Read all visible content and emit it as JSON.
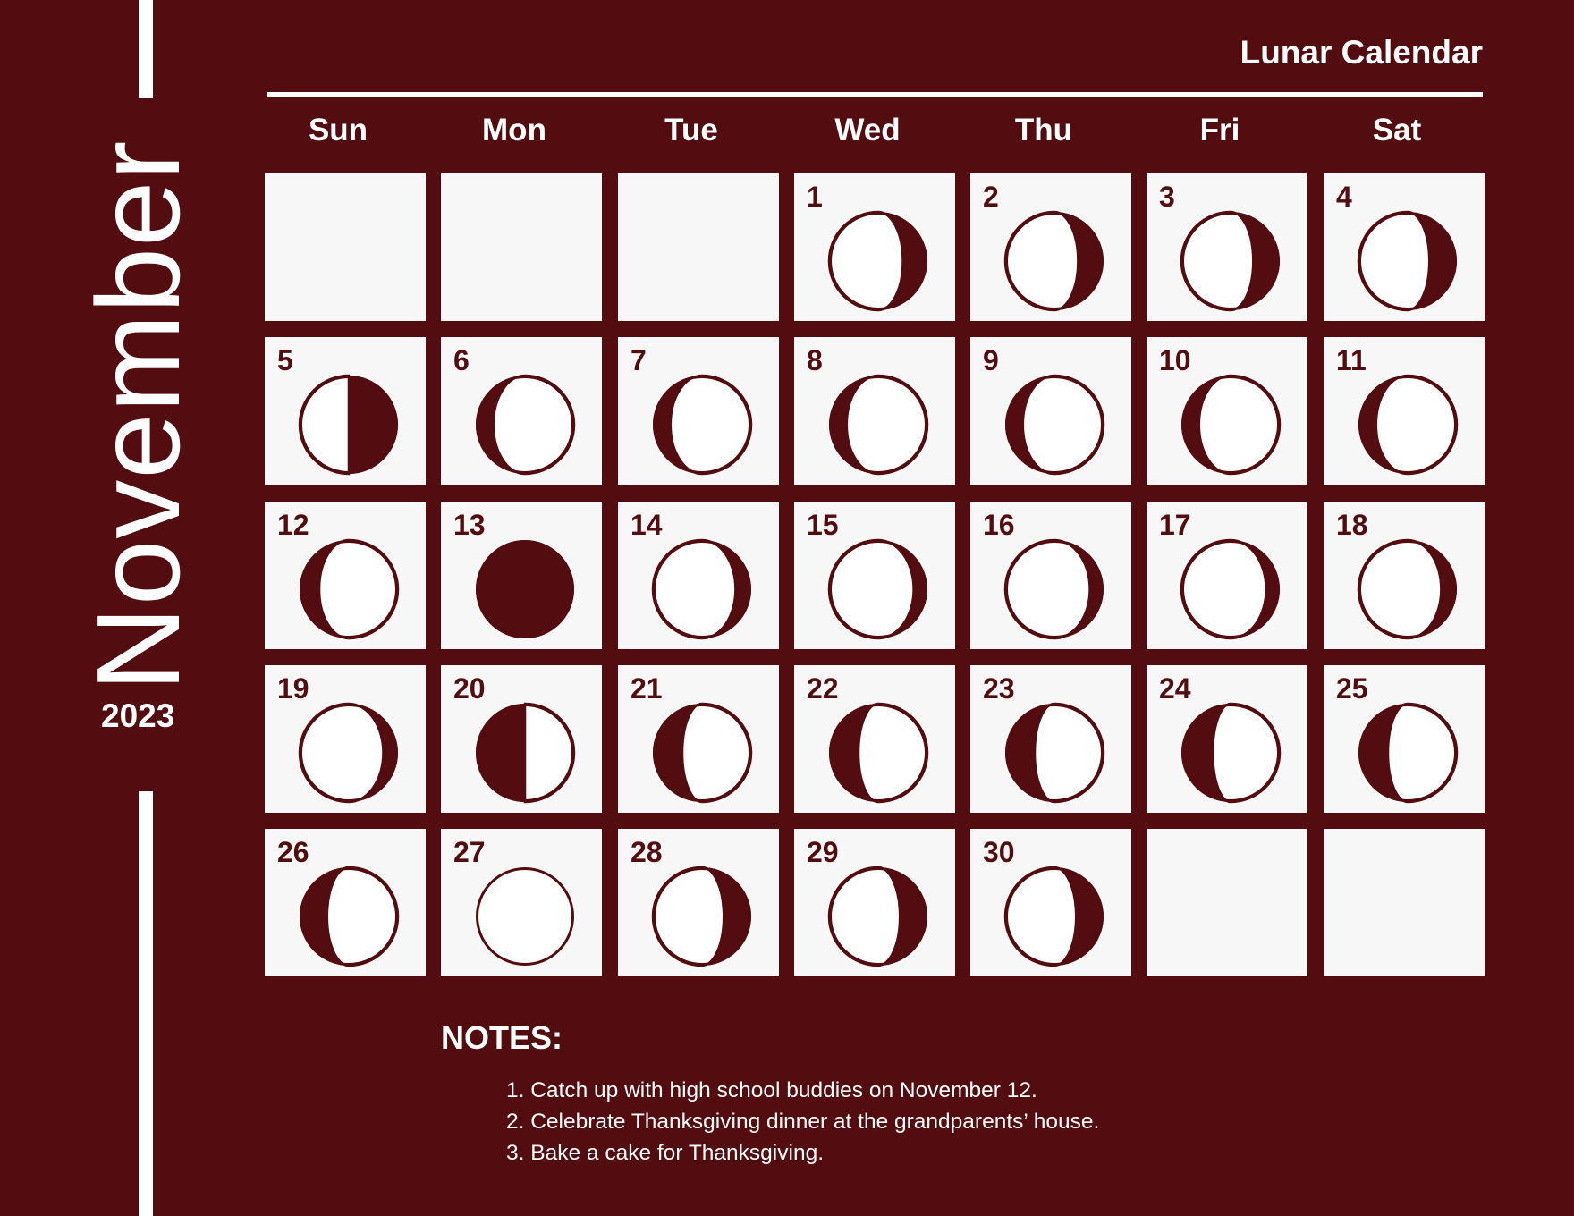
{
  "header": {
    "title": "Lunar Calendar"
  },
  "sidebar": {
    "month": "November",
    "year": "2023"
  },
  "colors": {
    "background": "#530d10",
    "cell": "#f7f7f7",
    "moon_dark": "#530d10",
    "moon_lit": "#ffffff",
    "text": "#ffffff"
  },
  "weekdays": [
    "Sun",
    "Mon",
    "Tue",
    "Wed",
    "Thu",
    "Fri",
    "Sat"
  ],
  "calendar": {
    "first_weekday_index": 3,
    "days_in_month": 30,
    "total_cells": 35,
    "days": [
      {
        "day": "1",
        "phase": "waning-gibbous",
        "lit_side": "left",
        "lit_fraction": 0.75
      },
      {
        "day": "2",
        "phase": "waning-gibbous",
        "lit_side": "left",
        "lit_fraction": 0.74
      },
      {
        "day": "3",
        "phase": "waning-gibbous",
        "lit_side": "left",
        "lit_fraction": 0.73
      },
      {
        "day": "4",
        "phase": "waning-gibbous",
        "lit_side": "left",
        "lit_fraction": 0.72
      },
      {
        "day": "5",
        "phase": "last-quarter",
        "lit_side": "left",
        "lit_fraction": 0.5
      },
      {
        "day": "6",
        "phase": "gibbous",
        "lit_side": "right",
        "lit_fraction": 0.82
      },
      {
        "day": "7",
        "phase": "gibbous",
        "lit_side": "right",
        "lit_fraction": 0.82
      },
      {
        "day": "8",
        "phase": "gibbous",
        "lit_side": "right",
        "lit_fraction": 0.82
      },
      {
        "day": "9",
        "phase": "gibbous",
        "lit_side": "right",
        "lit_fraction": 0.82
      },
      {
        "day": "10",
        "phase": "gibbous",
        "lit_side": "right",
        "lit_fraction": 0.82
      },
      {
        "day": "11",
        "phase": "gibbous",
        "lit_side": "right",
        "lit_fraction": 0.82
      },
      {
        "day": "12",
        "phase": "gibbous",
        "lit_side": "right",
        "lit_fraction": 0.8
      },
      {
        "day": "13",
        "phase": "new-moon",
        "lit_side": "none",
        "lit_fraction": 0
      },
      {
        "day": "14",
        "phase": "gibbous",
        "lit_side": "left",
        "lit_fraction": 0.84
      },
      {
        "day": "15",
        "phase": "gibbous",
        "lit_side": "left",
        "lit_fraction": 0.86
      },
      {
        "day": "16",
        "phase": "gibbous",
        "lit_side": "left",
        "lit_fraction": 0.86
      },
      {
        "day": "17",
        "phase": "gibbous",
        "lit_side": "left",
        "lit_fraction": 0.86
      },
      {
        "day": "18",
        "phase": "gibbous",
        "lit_side": "left",
        "lit_fraction": 0.84
      },
      {
        "day": "19",
        "phase": "gibbous",
        "lit_side": "left",
        "lit_fraction": 0.85
      },
      {
        "day": "20",
        "phase": "first-quarter",
        "lit_side": "right",
        "lit_fraction": 0.5
      },
      {
        "day": "21",
        "phase": "waxing-gibbous",
        "lit_side": "right",
        "lit_fraction": 0.7
      },
      {
        "day": "22",
        "phase": "waxing-gibbous",
        "lit_side": "right",
        "lit_fraction": 0.7
      },
      {
        "day": "23",
        "phase": "waxing-gibbous",
        "lit_side": "right",
        "lit_fraction": 0.7
      },
      {
        "day": "24",
        "phase": "waxing-gibbous",
        "lit_side": "right",
        "lit_fraction": 0.68
      },
      {
        "day": "25",
        "phase": "waxing-gibbous",
        "lit_side": "right",
        "lit_fraction": 0.7
      },
      {
        "day": "26",
        "phase": "waxing-gibbous",
        "lit_side": "right",
        "lit_fraction": 0.72
      },
      {
        "day": "27",
        "phase": "full-moon",
        "lit_side": "both",
        "lit_fraction": 1
      },
      {
        "day": "28",
        "phase": "waning-gibbous",
        "lit_side": "left",
        "lit_fraction": 0.72
      },
      {
        "day": "29",
        "phase": "waning-gibbous",
        "lit_side": "left",
        "lit_fraction": 0.72
      },
      {
        "day": "30",
        "phase": "waning-gibbous",
        "lit_side": "left",
        "lit_fraction": 0.72
      }
    ]
  },
  "notes": {
    "title": "NOTES:",
    "items": [
      "1. Catch up with high school buddies on November 12.",
      "2. Celebrate Thanksgiving dinner at the grandparents’ house.",
      "3. Bake a cake for Thanksgiving."
    ]
  }
}
